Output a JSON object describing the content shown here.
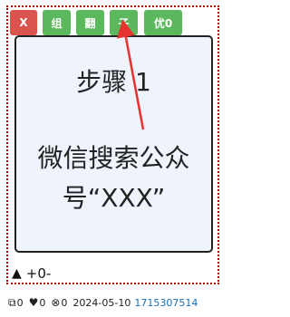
{
  "toolbar": {
    "close_label": "X",
    "group_label": "组",
    "translate_label": "翻",
    "child_label": "子",
    "priority_label": "优0"
  },
  "card": {
    "title": "步骤 1",
    "line1": "微信搜索公众",
    "line2": "号“XXX”"
  },
  "score": {
    "icon": "up-triangle-icon",
    "text": "+0-"
  },
  "meta": {
    "copies": "0",
    "likes": "0",
    "dislikes": "0",
    "date": "2024-05-10",
    "id": "1715307514"
  },
  "colors": {
    "close_button": "#d9534f",
    "action_buttons": "#5cb85c",
    "card_bg": "#eef3fc",
    "border_dotted": "#b30000",
    "arrow": "#e8322f",
    "link": "#1a6fb5"
  }
}
